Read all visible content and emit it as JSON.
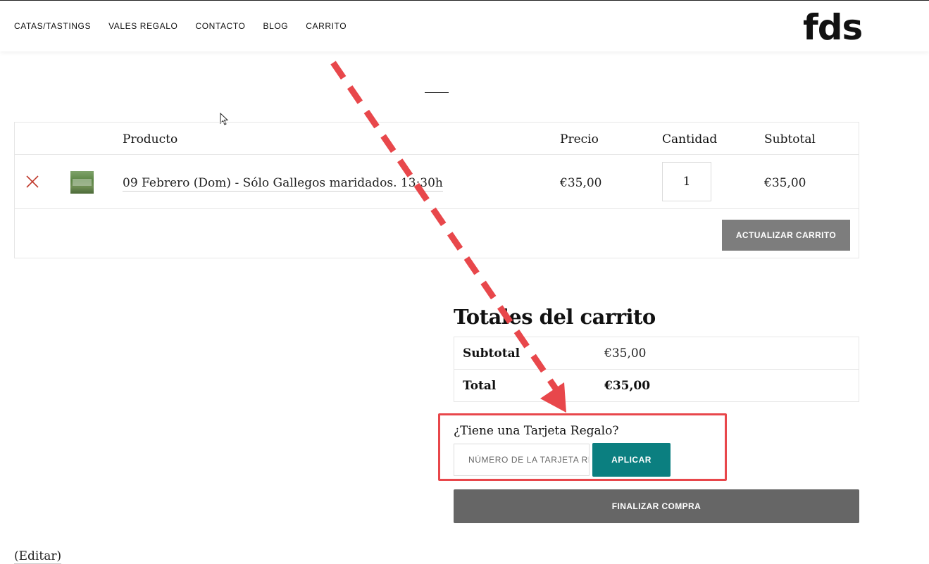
{
  "nav": {
    "items": [
      "CATAS/TASTINGS",
      "VALES REGALO",
      "CONTACTO",
      "BLOG",
      "CARRITO"
    ],
    "logo": "fds"
  },
  "cart": {
    "headers": {
      "product": "Producto",
      "price": "Precio",
      "quantity": "Cantidad",
      "subtotal": "Subtotal"
    },
    "rows": [
      {
        "product": "09 Febrero (Dom) - Sólo Gallegos maridados. 13:30h",
        "price": "€35,00",
        "quantity": "1",
        "subtotal": "€35,00"
      }
    ],
    "update_button": "ACTUALIZAR CARRITO"
  },
  "totals": {
    "title": "Totales del carrito",
    "subtotal_label": "Subtotal",
    "subtotal_value": "€35,00",
    "total_label": "Total",
    "total_value": "€35,00"
  },
  "gift_card": {
    "question": "¿Tiene una Tarjeta Regalo?",
    "placeholder": "NÚMERO DE LA TARJETA REGALO",
    "apply_button": "APLICAR"
  },
  "checkout_button": "FINALIZAR COMPRA",
  "edit_link": "(Editar)",
  "colors": {
    "annotation": "#e8474b",
    "apply_button": "#0b7f80",
    "checkout_button": "#666666",
    "update_button": "#7d7d7d",
    "remove_icon": "#c0392b"
  },
  "icons": {
    "remove": "close-x-icon",
    "cursor": "mouse-pointer-icon"
  }
}
